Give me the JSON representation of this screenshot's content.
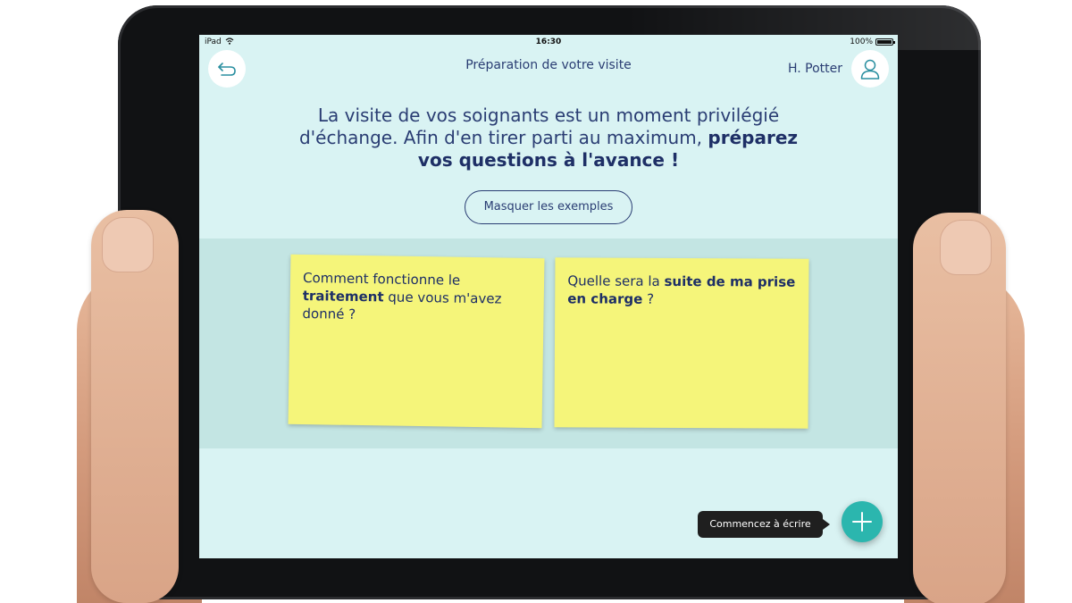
{
  "status_bar": {
    "device": "iPad",
    "time": "16:30",
    "battery": "100%"
  },
  "header": {
    "title": "Préparation de votre visite",
    "user_name": "H. Potter"
  },
  "intro": {
    "text_regular": "La visite de vos soignants est un moment privilégié d'échange. Afin d'en tirer parti au maximum, ",
    "text_bold": "préparez vos questions à l'avance !"
  },
  "toggle_examples_label": "Masquer les exemples",
  "examples": [
    {
      "before": "Comment fonctionne le ",
      "bold": "traitement",
      "after": " que vous m'avez donné ?"
    },
    {
      "before": "Quelle sera la ",
      "bold": "suite de ma prise en charge",
      "after": " ?"
    }
  ],
  "tooltip": "Commencez à écrire",
  "icons": {
    "back": "back-arrow-icon",
    "user": "user-icon",
    "add": "plus-icon",
    "wifi": "wifi-icon",
    "battery": "battery-icon"
  },
  "colors": {
    "screen_bg": "#d9f3f3",
    "band_bg": "#c3e5e3",
    "text_primary": "#2a3d73",
    "sticky_note": "#f5f57a",
    "fab": "#2bb6ae"
  }
}
